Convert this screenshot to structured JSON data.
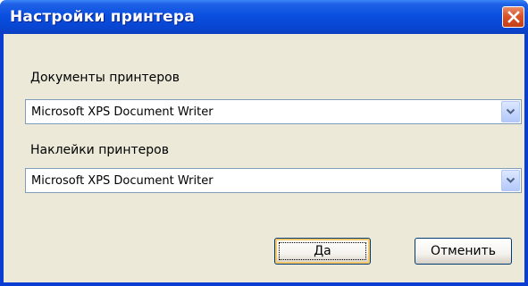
{
  "window": {
    "title": "Настройки принтера",
    "close_icon": "close-icon"
  },
  "documents": {
    "label": "Документы принтеров",
    "selected": "Microsoft XPS Document Writer"
  },
  "labels": {
    "label": "Наклейки принтеров",
    "selected": "Microsoft XPS Document Writer"
  },
  "buttons": {
    "ok": "Да",
    "cancel": "Отменить"
  },
  "colors": {
    "titlebar": "#0a4fe0",
    "client": "#ece9d8",
    "close": "#d9542b"
  }
}
